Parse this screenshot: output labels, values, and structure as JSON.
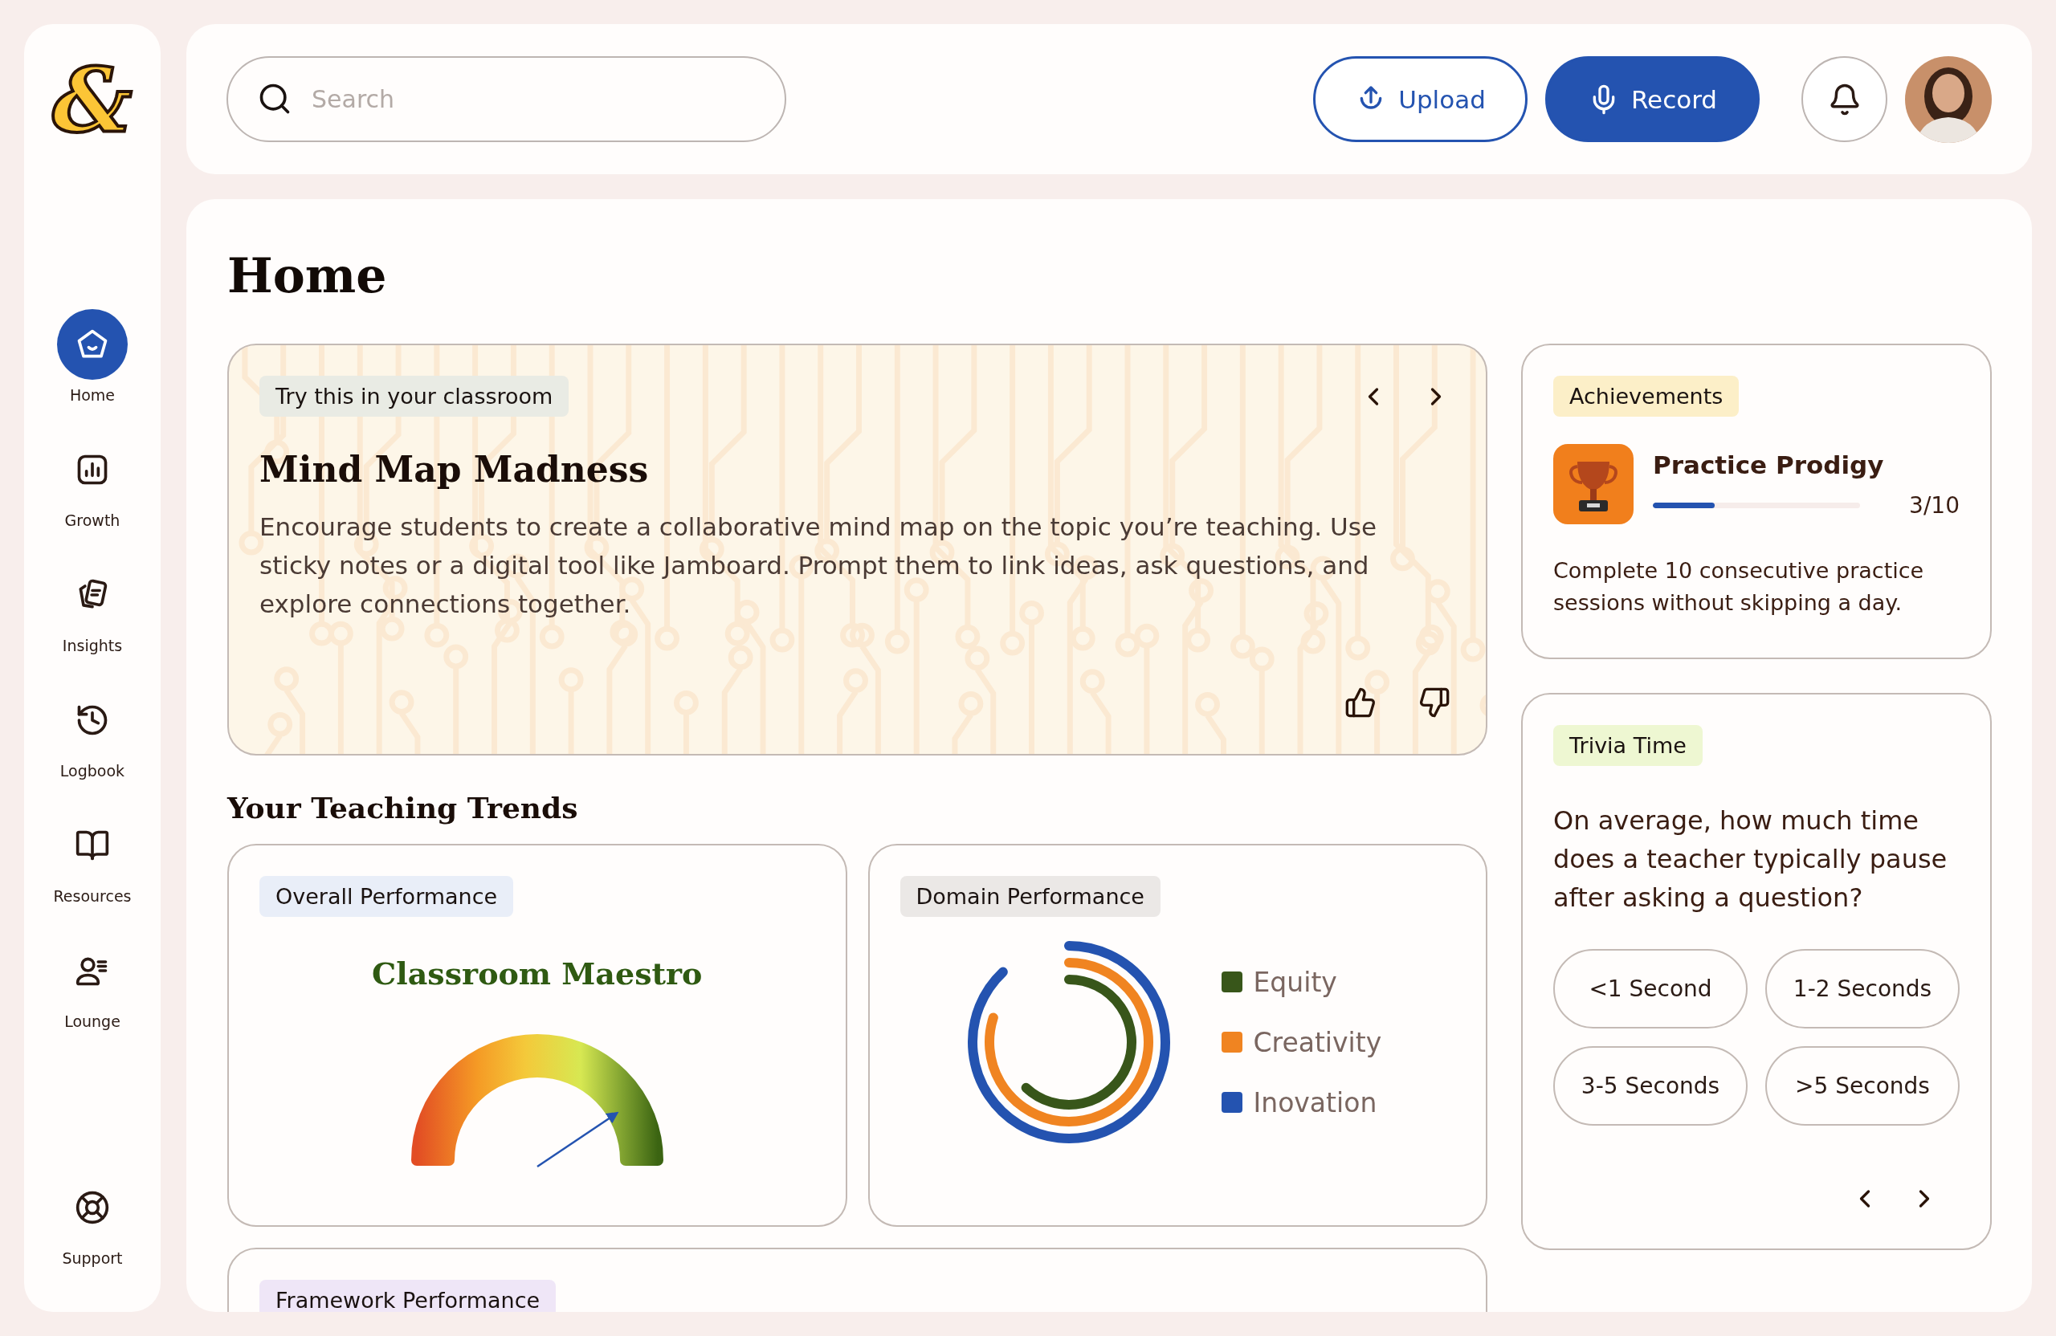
{
  "logo": "&",
  "sidebar": {
    "items": [
      {
        "label": "Home",
        "kind": "home",
        "selected": true
      },
      {
        "label": "Growth",
        "kind": "growth",
        "selected": false
      },
      {
        "label": "Insights",
        "kind": "insights",
        "selected": false
      },
      {
        "label": "Logbook",
        "kind": "logbook",
        "selected": false
      },
      {
        "label": "Resources",
        "kind": "resources",
        "selected": false
      },
      {
        "label": "Lounge",
        "kind": "lounge",
        "selected": false
      }
    ],
    "footer": {
      "label": "Support"
    }
  },
  "header": {
    "search": {
      "placeholder": "Search"
    },
    "buttons": [
      {
        "label": "Upload",
        "kind": "outline"
      },
      {
        "label": "Record",
        "kind": "filled"
      }
    ]
  },
  "page": {
    "title": "Home"
  },
  "tip": {
    "tag": "Try this in your classroom",
    "title": "Mind Map Madness",
    "body": "Encourage students to create a collaborative mind map on the topic you’re teaching. Use sticky notes or a digital tool like Jamboard. Prompt them to link ideas, ask questions, and explore connections together."
  },
  "trends": {
    "title": "Your Teaching Trends",
    "overall": {
      "tag": "Overall Performance",
      "rank": "Classroom Maestro"
    },
    "domain": {
      "tag": "Domain Performance",
      "series": [
        {
          "name": "Equity",
          "color": "#38561a"
        },
        {
          "name": "Creativity",
          "color": "#f08421"
        },
        {
          "name": "Inovation",
          "color": "#2453b0"
        }
      ]
    },
    "framework": {
      "tag": "Framework Performance"
    }
  },
  "achievements": {
    "tag": "Achievements",
    "title": "Practice Prodigy",
    "level": 0.3,
    "count": "3/10",
    "description": "Complete 10 consecutive practice sessions without skipping a day."
  },
  "trivia": {
    "tag": "Trivia Time",
    "question": "On average, how much time does a teacher typically pause after asking a question?",
    "options": [
      {
        "label": "<1 Second"
      },
      {
        "label": "1-2 Seconds"
      },
      {
        "label": "3-5 Seconds"
      },
      {
        "label": ">5 Seconds"
      }
    ]
  }
}
